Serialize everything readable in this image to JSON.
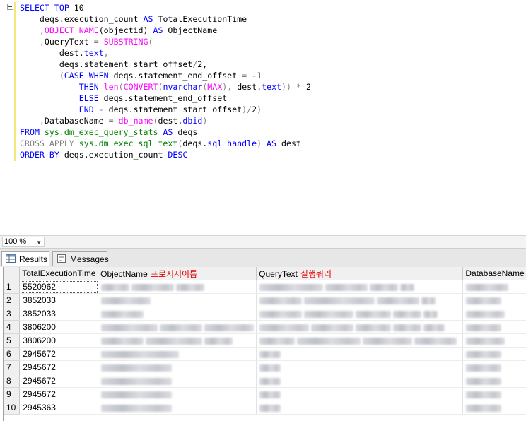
{
  "editor": {
    "lines": [
      [
        {
          "t": "SELECT TOP ",
          "c": "kw"
        },
        {
          "t": "10",
          "c": ""
        }
      ],
      [
        {
          "t": "    deqs.execution_count ",
          "c": ""
        },
        {
          "t": "AS",
          "c": "kw"
        },
        {
          "t": " TotalExecutionTime",
          "c": ""
        }
      ],
      [
        {
          "t": "    ,",
          "c": "gy"
        },
        {
          "t": "OBJECT_NAME",
          "c": "fn"
        },
        {
          "t": "(objectid) ",
          "c": ""
        },
        {
          "t": "AS",
          "c": "kw"
        },
        {
          "t": " ObjectName",
          "c": ""
        }
      ],
      [
        {
          "t": "    ,",
          "c": "gy"
        },
        {
          "t": "QueryText ",
          "c": ""
        },
        {
          "t": "= ",
          "c": "gy"
        },
        {
          "t": "SUBSTRING",
          "c": "fn"
        },
        {
          "t": "(",
          "c": "gy"
        }
      ],
      [
        {
          "t": "        dest.",
          "c": ""
        },
        {
          "t": "text",
          "c": "kw"
        },
        {
          "t": ",",
          "c": "gy"
        }
      ],
      [
        {
          "t": "        deqs.statement_start_offset",
          "c": ""
        },
        {
          "t": "/",
          "c": "gy"
        },
        {
          "t": "2,",
          "c": ""
        }
      ],
      [
        {
          "t": "        (",
          "c": "gy"
        },
        {
          "t": "CASE WHEN",
          "c": "kw"
        },
        {
          "t": " deqs.statement_end_offset ",
          "c": ""
        },
        {
          "t": "= -",
          "c": "gy"
        },
        {
          "t": "1",
          "c": ""
        }
      ],
      [
        {
          "t": "            ",
          "c": ""
        },
        {
          "t": "THEN",
          "c": "kw"
        },
        {
          "t": " ",
          "c": ""
        },
        {
          "t": "len",
          "c": "fn"
        },
        {
          "t": "(",
          "c": "gy"
        },
        {
          "t": "CONVERT",
          "c": "fn"
        },
        {
          "t": "(",
          "c": "gy"
        },
        {
          "t": "nvarchar",
          "c": "kw"
        },
        {
          "t": "(",
          "c": "gy"
        },
        {
          "t": "MAX",
          "c": "fn"
        },
        {
          "t": "),",
          "c": "gy"
        },
        {
          "t": " dest.",
          "c": ""
        },
        {
          "t": "text",
          "c": "kw"
        },
        {
          "t": ")) * ",
          "c": "gy"
        },
        {
          "t": "2",
          "c": ""
        }
      ],
      [
        {
          "t": "            ",
          "c": ""
        },
        {
          "t": "ELSE",
          "c": "kw"
        },
        {
          "t": " deqs.statement_end_offset",
          "c": ""
        }
      ],
      [
        {
          "t": "            ",
          "c": ""
        },
        {
          "t": "END",
          "c": "kw"
        },
        {
          "t": " - ",
          "c": "gy"
        },
        {
          "t": "deqs.statement_start_offset",
          "c": ""
        },
        {
          "t": ")/",
          "c": "gy"
        },
        {
          "t": "2",
          "c": ""
        },
        {
          "t": ")",
          "c": "gy"
        }
      ],
      [
        {
          "t": "    ,",
          "c": "gy"
        },
        {
          "t": "DatabaseName ",
          "c": ""
        },
        {
          "t": "= ",
          "c": "gy"
        },
        {
          "t": "db_name",
          "c": "fn"
        },
        {
          "t": "(",
          "c": "gy"
        },
        {
          "t": "dest.",
          "c": ""
        },
        {
          "t": "dbid",
          "c": "kw"
        },
        {
          "t": ")",
          "c": "gy"
        }
      ],
      [
        {
          "t": "FROM",
          "c": "kw"
        },
        {
          "t": " ",
          "c": ""
        },
        {
          "t": "sys.dm_exec_query_stats",
          "c": "sys"
        },
        {
          "t": " ",
          "c": ""
        },
        {
          "t": "AS",
          "c": "kw"
        },
        {
          "t": " deqs",
          "c": ""
        }
      ],
      [
        {
          "t": "CROSS APPLY",
          "c": "gy"
        },
        {
          "t": " ",
          "c": ""
        },
        {
          "t": "sys.dm_exec_sql_text",
          "c": "sys"
        },
        {
          "t": "(",
          "c": "gy"
        },
        {
          "t": "deqs.",
          "c": ""
        },
        {
          "t": "sql_handle",
          "c": "kw"
        },
        {
          "t": ") ",
          "c": "gy"
        },
        {
          "t": "AS",
          "c": "kw"
        },
        {
          "t": " dest",
          "c": ""
        }
      ],
      [
        {
          "t": "ORDER BY",
          "c": "kw"
        },
        {
          "t": " deqs.execution_count ",
          "c": ""
        },
        {
          "t": "DESC",
          "c": "kw"
        }
      ]
    ]
  },
  "zoom": {
    "value": "100 %"
  },
  "tabs": {
    "results": "Results",
    "messages": "Messages"
  },
  "grid": {
    "headers": {
      "total": "TotalExecutionTime",
      "object": "ObjectName",
      "object_note": "프로시저이름",
      "query": "QueryText",
      "query_note": "실행쿼리",
      "db": "DatabaseName"
    },
    "rows": [
      {
        "n": "1",
        "v": "5520962"
      },
      {
        "n": "2",
        "v": "3852033"
      },
      {
        "n": "3",
        "v": "3852033"
      },
      {
        "n": "4",
        "v": "3806200"
      },
      {
        "n": "5",
        "v": "3806200"
      },
      {
        "n": "6",
        "v": "2945672"
      },
      {
        "n": "7",
        "v": "2945672"
      },
      {
        "n": "8",
        "v": "2945672"
      },
      {
        "n": "9",
        "v": "2945672"
      },
      {
        "n": "10",
        "v": "2945363"
      }
    ]
  }
}
